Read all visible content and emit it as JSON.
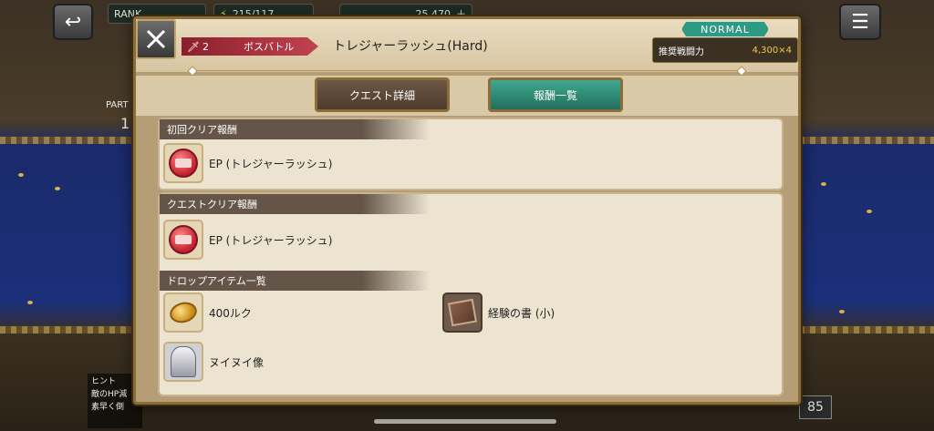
{
  "background": {
    "rank_label": "RANK",
    "stamina_text": "215/117",
    "currency_text": "25,470",
    "party_label": "PART",
    "party_num": "1",
    "hint_title": "ヒント",
    "hint_line1": "敵のHP減",
    "hint_line2": "素早く倒",
    "stage_badge": "85"
  },
  "modal": {
    "boss_number": "2",
    "boss_label": "ボスバトル",
    "title": "トレジャーラッシュ(Hard)",
    "difficulty": "NORMAL",
    "power_label": "推奨戦闘力",
    "power_value": "4,300×4",
    "tabs": [
      {
        "label": "クエスト詳細",
        "active": false
      },
      {
        "label": "報酬一覧",
        "active": true
      }
    ],
    "sections": [
      {
        "header": "初回クリア報酬",
        "items": [
          {
            "name": "EP (トレジャーラッシュ)",
            "icon": "ep-medal-icon"
          }
        ]
      },
      {
        "header": "クエストクリア報酬",
        "items": [
          {
            "name": "EP (トレジャーラッシュ)",
            "icon": "ep-medal-icon"
          }
        ]
      },
      {
        "header": "ドロップアイテム一覧",
        "items": [
          {
            "name": "400ルク",
            "icon": "coin-icon"
          },
          {
            "name": "経験の書 (小)",
            "icon": "book-icon"
          },
          {
            "name": "ヌイヌイ像",
            "icon": "statue-icon"
          }
        ]
      }
    ]
  },
  "colors": {
    "active_tab": "#2f8f78",
    "inactive_tab": "#5a4636",
    "boss_tag": "#b23a48",
    "difficulty_badge": "#2f9a84",
    "power_value": "#f4c84e"
  }
}
